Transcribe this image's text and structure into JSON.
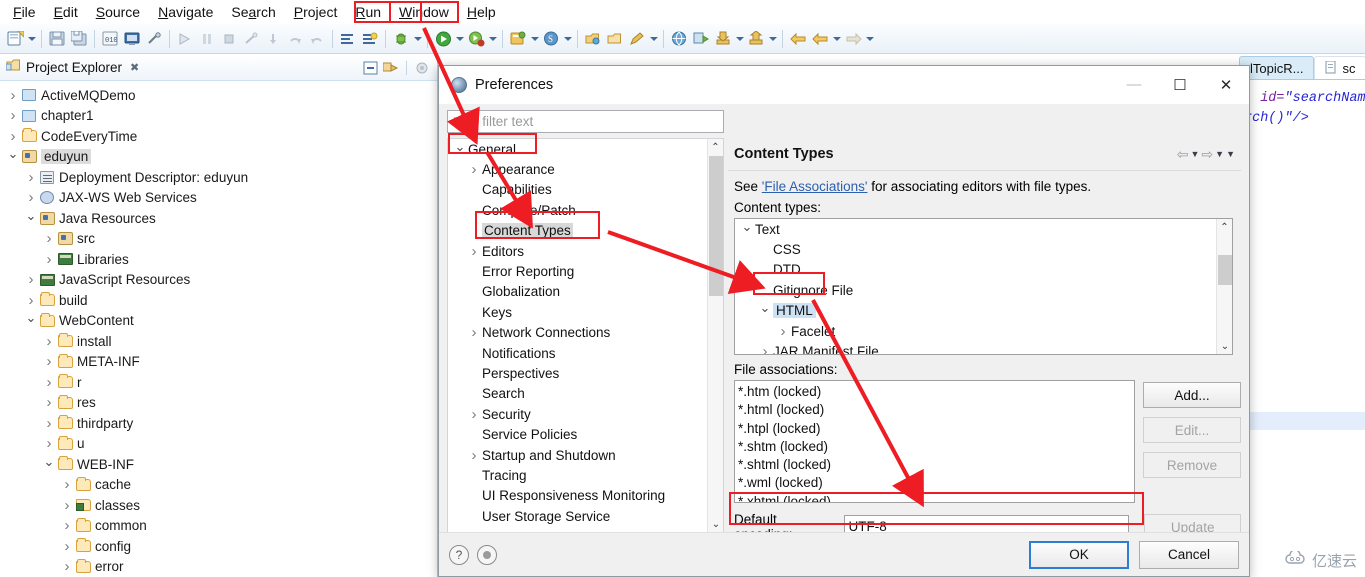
{
  "menubar": {
    "items": [
      {
        "label": "File",
        "accel": "F",
        "highlighted": false
      },
      {
        "label": "Edit",
        "accel": "E",
        "highlighted": false
      },
      {
        "label": "Source",
        "accel": "S",
        "highlighted": false
      },
      {
        "label": "Navigate",
        "accel": "N",
        "highlighted": false
      },
      {
        "label": "Search",
        "accel": "a",
        "highlighted": false
      },
      {
        "label": "Project",
        "accel": "P",
        "highlighted": false
      },
      {
        "label": "Run",
        "accel": "R",
        "highlighted": false
      },
      {
        "label": "Window",
        "accel": "W",
        "highlighted": true
      },
      {
        "label": "Help",
        "accel": "H",
        "highlighted": false
      }
    ]
  },
  "project_explorer": {
    "tab_label": "Project Explorer",
    "close_glyph": "✖",
    "toolbar_icons": [
      "collapse-all-icon",
      "link-with-editor-icon",
      "view-menu-icon"
    ],
    "tree": [
      {
        "label": "ActiveMQDemo",
        "indent": 0,
        "twisty": "right",
        "icon": "project-closed-icon",
        "selected": false
      },
      {
        "label": "chapter1",
        "indent": 0,
        "twisty": "right",
        "icon": "project-closed-icon",
        "selected": false
      },
      {
        "label": "CodeEveryTime",
        "indent": 0,
        "twisty": "right",
        "icon": "project-open-icon",
        "selected": false
      },
      {
        "label": "eduyun",
        "indent": 0,
        "twisty": "down",
        "icon": "java-project-icon",
        "selected": true
      },
      {
        "label": "Deployment Descriptor: eduyun",
        "indent": 1,
        "twisty": "right",
        "icon": "deployment-descriptor-icon",
        "selected": false
      },
      {
        "label": "JAX-WS Web Services",
        "indent": 1,
        "twisty": "right",
        "icon": "web-service-icon",
        "selected": false
      },
      {
        "label": "Java Resources",
        "indent": 1,
        "twisty": "down",
        "icon": "java-resources-icon",
        "selected": false
      },
      {
        "label": "src",
        "indent": 2,
        "twisty": "right",
        "icon": "source-folder-icon",
        "selected": false
      },
      {
        "label": "Libraries",
        "indent": 2,
        "twisty": "right",
        "icon": "library-icon",
        "selected": false
      },
      {
        "label": "JavaScript Resources",
        "indent": 1,
        "twisty": "right",
        "icon": "library-icon",
        "selected": false
      },
      {
        "label": "build",
        "indent": 1,
        "twisty": "right",
        "icon": "folder-open-icon",
        "selected": false
      },
      {
        "label": "WebContent",
        "indent": 1,
        "twisty": "down",
        "icon": "folder-open-icon",
        "selected": false
      },
      {
        "label": "install",
        "indent": 2,
        "twisty": "right",
        "icon": "folder-open-icon",
        "selected": false
      },
      {
        "label": "META-INF",
        "indent": 2,
        "twisty": "right",
        "icon": "folder-open-icon",
        "selected": false
      },
      {
        "label": "r",
        "indent": 2,
        "twisty": "right",
        "icon": "folder-open-icon",
        "selected": false
      },
      {
        "label": "res",
        "indent": 2,
        "twisty": "right",
        "icon": "folder-open-icon",
        "selected": false
      },
      {
        "label": "thirdparty",
        "indent": 2,
        "twisty": "right",
        "icon": "folder-open-icon",
        "selected": false
      },
      {
        "label": "u",
        "indent": 2,
        "twisty": "right",
        "icon": "folder-open-icon",
        "selected": false
      },
      {
        "label": "WEB-INF",
        "indent": 2,
        "twisty": "down",
        "icon": "folder-open-icon",
        "selected": false
      },
      {
        "label": "cache",
        "indent": 3,
        "twisty": "right",
        "icon": "folder-open-icon",
        "selected": false
      },
      {
        "label": "classes",
        "indent": 3,
        "twisty": "right",
        "icon": "classes-folder-icon",
        "selected": false
      },
      {
        "label": "common",
        "indent": 3,
        "twisty": "right",
        "icon": "folder-open-icon",
        "selected": false
      },
      {
        "label": "config",
        "indent": 3,
        "twisty": "right",
        "icon": "folder-open-icon",
        "selected": false
      },
      {
        "label": "error",
        "indent": 3,
        "twisty": "right",
        "icon": "folder-open-icon",
        "selected": false
      }
    ]
  },
  "editor": {
    "tabs": [
      {
        "label": "lTopicR...",
        "active": true
      },
      {
        "label": "sc",
        "active": false
      }
    ],
    "code_line1_a": "' ",
    "code_line1_b": "id=",
    "code_line1_c": "\"searchNam",
    "code_line2": "rch()\"/>"
  },
  "dialog": {
    "title": "Preferences",
    "icon": "preferences-icon",
    "window_buttons": {
      "minimize": "—",
      "maximize": "☐",
      "close": "✕"
    },
    "filter_placeholder": "type filter text",
    "filter_value": "",
    "left_tree": [
      {
        "label": "General",
        "indent": 0,
        "twisty": "down",
        "selected": false
      },
      {
        "label": "Appearance",
        "indent": 1,
        "twisty": "right",
        "selected": false
      },
      {
        "label": "Capabilities",
        "indent": 1,
        "twisty": "none",
        "selected": false
      },
      {
        "label": "Compare/Patch",
        "indent": 1,
        "twisty": "none",
        "selected": false
      },
      {
        "label": "Content Types",
        "indent": 1,
        "twisty": "none",
        "selected": true
      },
      {
        "label": "Editors",
        "indent": 1,
        "twisty": "right",
        "selected": false
      },
      {
        "label": "Error Reporting",
        "indent": 1,
        "twisty": "none",
        "selected": false
      },
      {
        "label": "Globalization",
        "indent": 1,
        "twisty": "none",
        "selected": false
      },
      {
        "label": "Keys",
        "indent": 1,
        "twisty": "none",
        "selected": false
      },
      {
        "label": "Network Connections",
        "indent": 1,
        "twisty": "right",
        "selected": false
      },
      {
        "label": "Notifications",
        "indent": 1,
        "twisty": "none",
        "selected": false
      },
      {
        "label": "Perspectives",
        "indent": 1,
        "twisty": "none",
        "selected": false
      },
      {
        "label": "Search",
        "indent": 1,
        "twisty": "none",
        "selected": false
      },
      {
        "label": "Security",
        "indent": 1,
        "twisty": "right",
        "selected": false
      },
      {
        "label": "Service Policies",
        "indent": 1,
        "twisty": "none",
        "selected": false
      },
      {
        "label": "Startup and Shutdown",
        "indent": 1,
        "twisty": "right",
        "selected": false
      },
      {
        "label": "Tracing",
        "indent": 1,
        "twisty": "none",
        "selected": false
      },
      {
        "label": "UI Responsiveness Monitoring",
        "indent": 1,
        "twisty": "none",
        "selected": false
      },
      {
        "label": "User Storage Service",
        "indent": 1,
        "twisty": "none",
        "selected": false
      }
    ],
    "panel": {
      "title": "Content Types",
      "desc_prefix": "See ",
      "desc_link": "'File Associations'",
      "desc_suffix": " for associating editors with file types.",
      "content_types_label": "Content types:",
      "content_types": [
        {
          "label": "Text",
          "indent": 0,
          "twisty": "down",
          "selected": false
        },
        {
          "label": "CSS",
          "indent": 1,
          "twisty": "none",
          "selected": false
        },
        {
          "label": "DTD",
          "indent": 1,
          "twisty": "none",
          "selected": false
        },
        {
          "label": "Gitignore File",
          "indent": 1,
          "twisty": "none",
          "selected": false
        },
        {
          "label": "HTML",
          "indent": 1,
          "twisty": "down",
          "selected": true
        },
        {
          "label": "Facelet",
          "indent": 2,
          "twisty": "right",
          "selected": false
        },
        {
          "label": "JAR Manifest File",
          "indent": 1,
          "twisty": "right",
          "selected": false
        }
      ],
      "file_associations_label": "File associations:",
      "file_associations": [
        "*.htm (locked)",
        "*.html (locked)",
        "*.htpl (locked)",
        "*.shtm (locked)",
        "*.shtml (locked)",
        "*.wml (locked)",
        "*.xhtml (locked)"
      ],
      "buttons": [
        {
          "label": "Add...",
          "enabled": true
        },
        {
          "label": "Edit...",
          "enabled": false
        },
        {
          "label": "Remove",
          "enabled": false
        }
      ],
      "encoding_label": "Default encoding:",
      "encoding_value": "UTF-8",
      "update_button": "Update"
    },
    "footer": {
      "help_glyph": "?",
      "restore_glyph": "●",
      "ok_label": "OK",
      "cancel_label": "Cancel"
    }
  },
  "annotations": {
    "color": "#ee1c23",
    "boxes": [
      "window-menu",
      "general-item",
      "content-types-item",
      "html-item",
      "default-encoding-row"
    ],
    "arrows": 5
  },
  "watermark": {
    "text": "亿速云",
    "icon": "cloud-icon"
  },
  "colors": {
    "accent_red": "#ee1c23",
    "selection_blue": "#cde1f4",
    "link_blue": "#2b5fb0",
    "default_button_border": "#2a7fd4",
    "toolbar_bg": "#eaf1f8"
  }
}
